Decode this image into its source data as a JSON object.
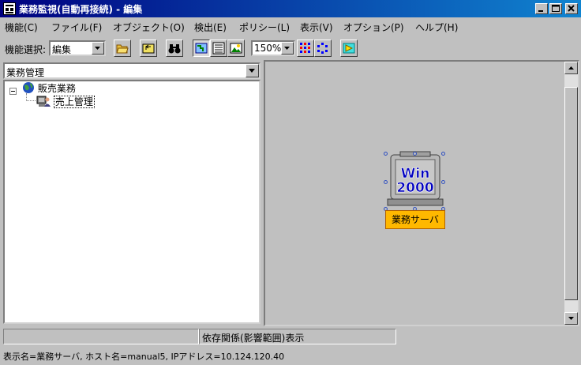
{
  "window": {
    "title": "業務監視(自動再接続) - 編集",
    "minimize_icon": "minimize-icon",
    "maximize_icon": "maximize-icon",
    "close_icon": "close-icon"
  },
  "menu": {
    "items": [
      "機能(C)",
      "ファイル(F)",
      "オブジェクト(O)",
      "検出(E)",
      "ポリシー(L)",
      "表示(V)",
      "オプション(P)",
      "ヘルプ(H)"
    ]
  },
  "toolbar": {
    "function_label": "機能選択:",
    "function_value": "編集",
    "zoom_value": "150%",
    "icons": [
      "open-folder-icon",
      "up-folder-icon",
      "binoculars-search-icon",
      "map-view-icon",
      "list-view-icon",
      "image-view-icon",
      "grid-layout-icon",
      "circle-layout-icon",
      "refresh-icon"
    ]
  },
  "left_panel": {
    "view_select": "業務管理",
    "tree": [
      {
        "label": "販売業務",
        "icon": "globe-icon",
        "expanded": true
      },
      {
        "label": "売上管理",
        "icon": "computer-user-icon",
        "selected": true
      }
    ]
  },
  "map": {
    "node": {
      "icon_text_top": "Win",
      "icon_text_bottom": "2000",
      "label": "業務サーバ",
      "label_color": "#ffb800"
    }
  },
  "status": {
    "center_text": "依存関係(影響範囲)表示",
    "info": "表示名=業務サーバ, ホスト名=manual5, IPアドレス=10.124.120.40"
  }
}
